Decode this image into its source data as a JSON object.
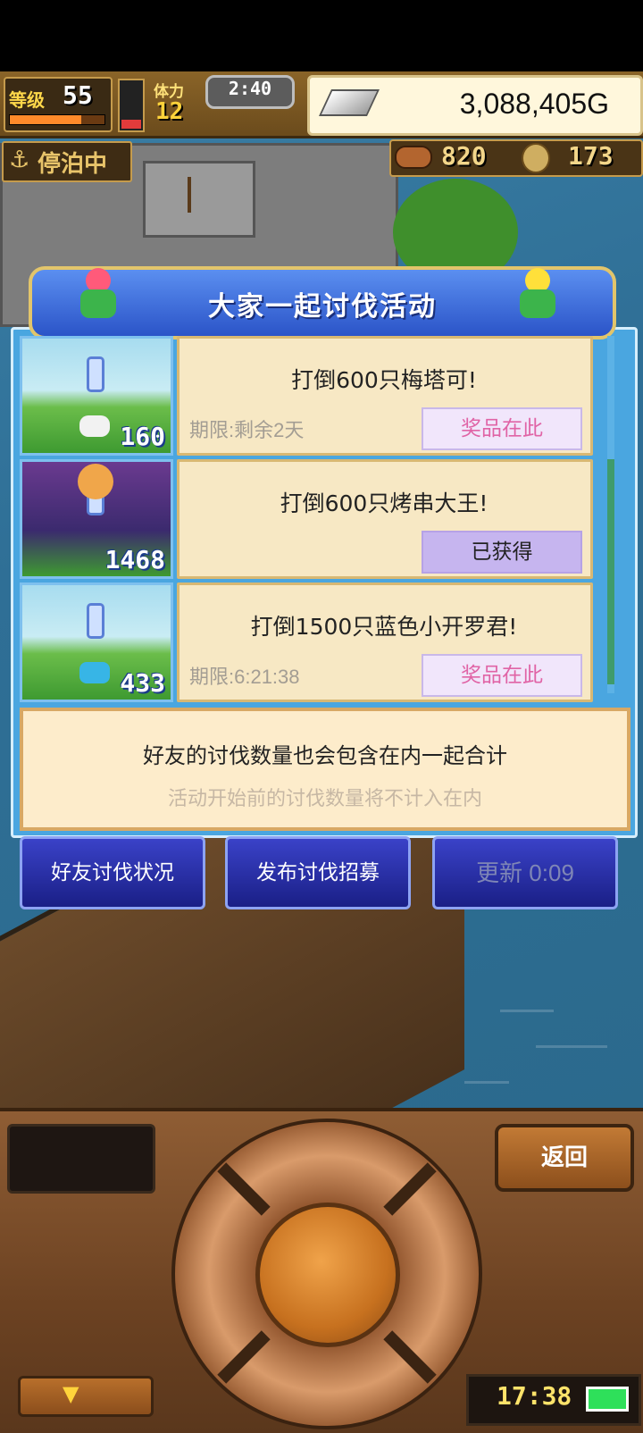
{
  "hud": {
    "level_label": "等级",
    "level_value": "55",
    "level_progress": 0.75,
    "stamina_label": "体力",
    "stamina_value": "12",
    "stamina_fill": 0.25,
    "timer": "2:40",
    "gold": "3,088,405G",
    "moor_status": "停泊中",
    "food": "820",
    "coins": "173"
  },
  "event": {
    "title": "大家一起讨伐活动",
    "quests": [
      {
        "target_count": "160",
        "title": "打倒600只梅塔可!",
        "limit": "期限:剩余2天",
        "reward_label": "奖品在此",
        "reward_state": "available"
      },
      {
        "target_count": "1468",
        "title": "打倒600只烤串大王!",
        "limit": "",
        "reward_label": "已获得",
        "reward_state": "obtained"
      },
      {
        "target_count": "433",
        "title": "打倒1500只蓝色小开罗君!",
        "limit": "期限:6:21:38",
        "reward_label": "奖品在此",
        "reward_state": "available"
      }
    ],
    "note_main": "好友的讨伐数量也会包含在内一起合计",
    "note_sub": "活动开始前的讨伐数量将不计入在内"
  },
  "actions": {
    "friend_status": "好友讨伐状况",
    "post_recruit": "发布讨伐招募",
    "refresh": "更新 0:09"
  },
  "control": {
    "back_label": "返回",
    "clock": "17:38"
  },
  "colors": {
    "panel_blue": "#4aa6e0",
    "header_blue": "#2b54c8",
    "reward_pink": "#e064a6",
    "obtained_purple": "#c6b5ef"
  }
}
